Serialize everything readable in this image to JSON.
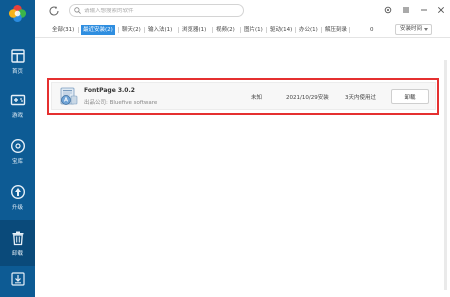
{
  "sidebar": {
    "items": [
      {
        "label": "首页",
        "icon": "home-icon"
      },
      {
        "label": "游戏",
        "icon": "gamepad-icon"
      },
      {
        "label": "宝库",
        "icon": "disc-icon"
      },
      {
        "label": "升级",
        "icon": "upgrade-arrow-icon"
      },
      {
        "label": "卸载",
        "icon": "trash-icon"
      }
    ],
    "active": "卸载"
  },
  "search": {
    "placeholder": "请输入想搜索的软件"
  },
  "tabs": [
    {
      "label": "全部(31)"
    },
    {
      "label": "最近安装(2)"
    },
    {
      "label": "聊天(2)"
    },
    {
      "label": "输入法(1)"
    },
    {
      "label": "浏览器(1)"
    },
    {
      "label": "视频(2)"
    },
    {
      "label": "图片(1)"
    },
    {
      "label": "驱动(14)"
    },
    {
      "label": "办公(1)"
    },
    {
      "label": "解压刻录"
    },
    {
      "label": "0"
    }
  ],
  "active_tab": "最近安装(2)",
  "sort": {
    "value": "安装时间"
  },
  "app": {
    "name": "FontPage 3.0.2",
    "publisher": "出品公司: Bluefive software",
    "size": "未知",
    "install_date": "2021/10/29安装",
    "usage": "3天内使用过",
    "uninstall_label": "卸载"
  },
  "colors": {
    "sidebar": "#0d5b94",
    "sidebar_active": "#0a4a7a",
    "tab_active": "#2f8ee0",
    "highlight": "#e53030"
  }
}
